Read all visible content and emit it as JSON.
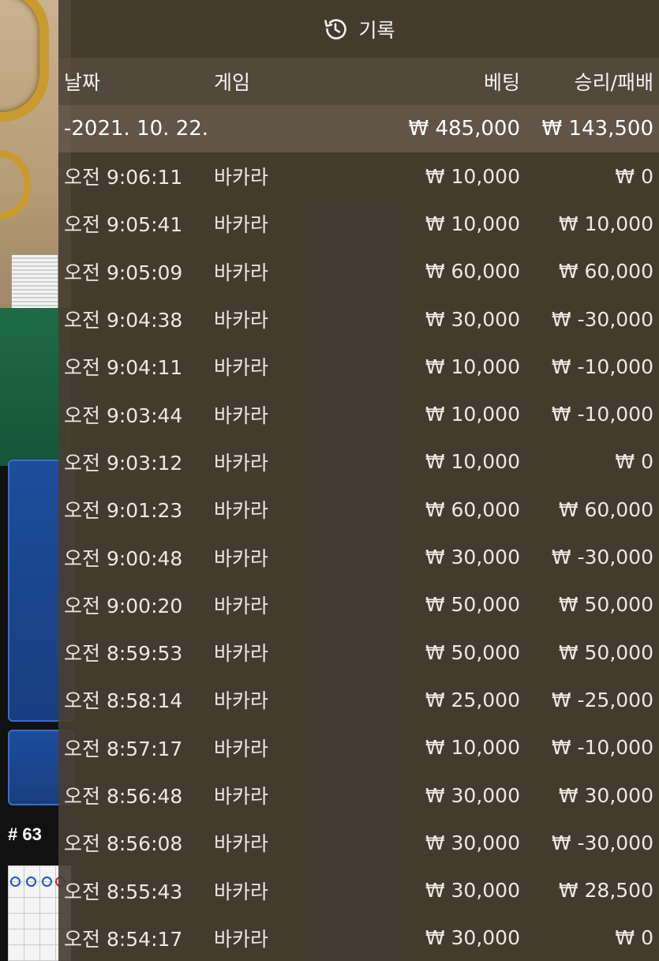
{
  "background": {
    "round_label": "# 63"
  },
  "panel": {
    "title": "기록",
    "icon": "history-clock-icon"
  },
  "columns": {
    "date": "날짜",
    "game": "게임",
    "bet": "베팅",
    "result": "승리/패배"
  },
  "day_group": {
    "date": "-2021. 10. 22.",
    "total_bet": "₩ 485,000",
    "total_result": "₩ 143,500"
  },
  "rows": [
    {
      "time": "오전 9:06:11",
      "game": "바카라",
      "bet": "₩ 10,000",
      "result": "₩ 0"
    },
    {
      "time": "오전 9:05:41",
      "game": "바카라",
      "bet": "₩ 10,000",
      "result": "₩ 10,000"
    },
    {
      "time": "오전 9:05:09",
      "game": "바카라",
      "bet": "₩ 60,000",
      "result": "₩ 60,000"
    },
    {
      "time": "오전 9:04:38",
      "game": "바카라",
      "bet": "₩ 30,000",
      "result": "₩ -30,000"
    },
    {
      "time": "오전 9:04:11",
      "game": "바카라",
      "bet": "₩ 10,000",
      "result": "₩ -10,000"
    },
    {
      "time": "오전 9:03:44",
      "game": "바카라",
      "bet": "₩ 10,000",
      "result": "₩ -10,000"
    },
    {
      "time": "오전 9:03:12",
      "game": "바카라",
      "bet": "₩ 10,000",
      "result": "₩ 0"
    },
    {
      "time": "오전 9:01:23",
      "game": "바카라",
      "bet": "₩ 60,000",
      "result": "₩ 60,000"
    },
    {
      "time": "오전 9:00:48",
      "game": "바카라",
      "bet": "₩ 30,000",
      "result": "₩ -30,000"
    },
    {
      "time": "오전 9:00:20",
      "game": "바카라",
      "bet": "₩ 50,000",
      "result": "₩ 50,000"
    },
    {
      "time": "오전 8:59:53",
      "game": "바카라",
      "bet": "₩ 50,000",
      "result": "₩ 50,000"
    },
    {
      "time": "오전 8:58:14",
      "game": "바카라",
      "bet": "₩ 25,000",
      "result": "₩ -25,000"
    },
    {
      "time": "오전 8:57:17",
      "game": "바카라",
      "bet": "₩ 10,000",
      "result": "₩ -10,000"
    },
    {
      "time": "오전 8:56:48",
      "game": "바카라",
      "bet": "₩ 30,000",
      "result": "₩ 30,000"
    },
    {
      "time": "오전 8:56:08",
      "game": "바카라",
      "bet": "₩ 30,000",
      "result": "₩ -30,000"
    },
    {
      "time": "오전 8:55:43",
      "game": "바카라",
      "bet": "₩ 30,000",
      "result": "₩ 28,500"
    },
    {
      "time": "오전 8:54:17",
      "game": "바카라",
      "bet": "₩ 30,000",
      "result": "₩ 0"
    }
  ]
}
